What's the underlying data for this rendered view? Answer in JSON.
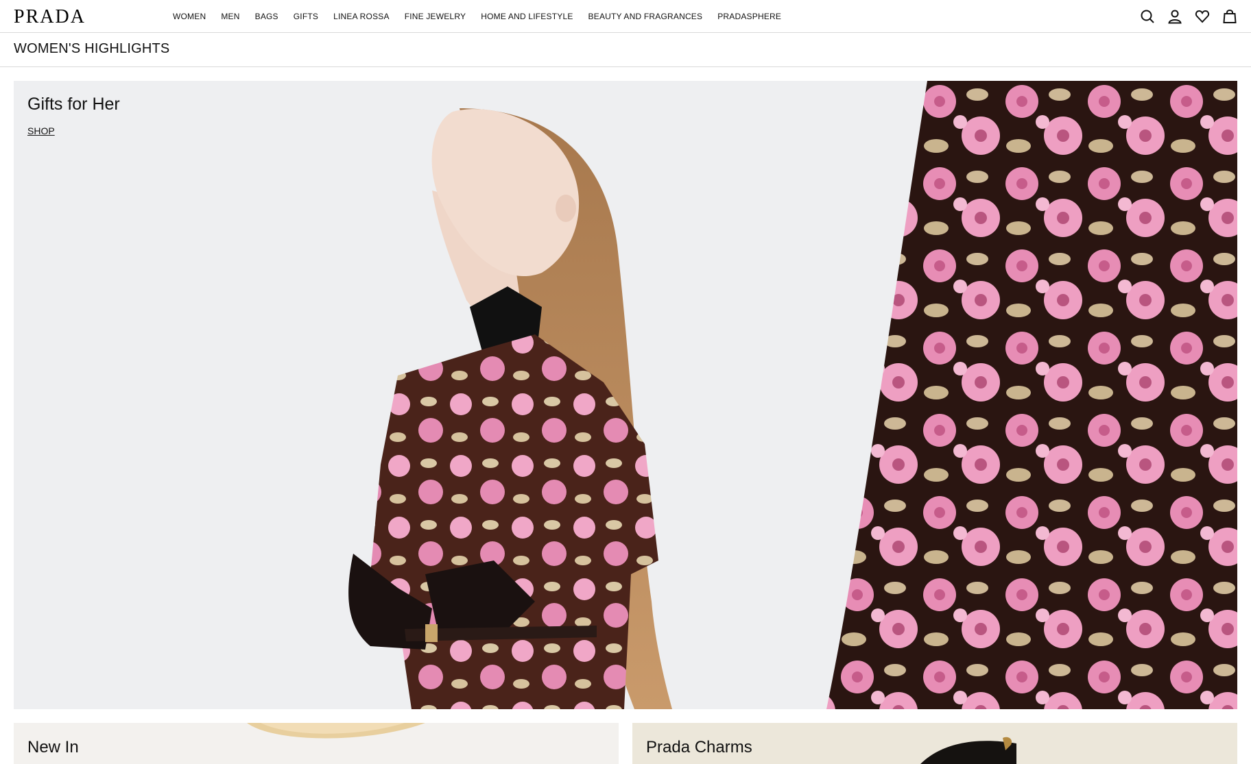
{
  "brand": {
    "logo_text": "PRADA"
  },
  "nav": {
    "items": [
      {
        "label": "WOMEN"
      },
      {
        "label": "MEN"
      },
      {
        "label": "BAGS"
      },
      {
        "label": "GIFTS"
      },
      {
        "label": "LINEA ROSSA"
      },
      {
        "label": "FINE JEWELRY"
      },
      {
        "label": "HOME AND LIFESTYLE"
      },
      {
        "label": "BEAUTY AND FRAGRANCES"
      },
      {
        "label": "PRADASPHERE"
      }
    ]
  },
  "header_icons": [
    "search-icon",
    "account-icon",
    "wishlist-icon",
    "bag-icon"
  ],
  "page": {
    "title": "WOMEN'S HIGHLIGHTS"
  },
  "hero": {
    "title": "Gifts for Her",
    "cta": "SHOP"
  },
  "cards": [
    {
      "title": "New In"
    },
    {
      "title": "Prada Charms"
    }
  ],
  "colors": {
    "hero_bg": "#eeeff1",
    "dress_pink": "#e58fb6",
    "dress_brown": "#3a1d17",
    "hair": "#b8875a"
  }
}
